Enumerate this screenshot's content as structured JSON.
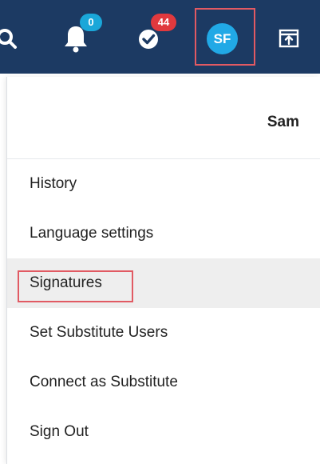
{
  "header": {
    "notifications_count": "0",
    "tasks_count": "44",
    "avatar_initials": "SF",
    "icons": [
      "search-icon",
      "bell-icon",
      "check-tasks-icon",
      "panel-icon"
    ]
  },
  "user_menu": {
    "user_name": "Sam",
    "items": [
      {
        "label": "History"
      },
      {
        "label": "Language settings"
      },
      {
        "label": "Signatures"
      },
      {
        "label": "Set Substitute Users"
      },
      {
        "label": "Connect as Substitute"
      },
      {
        "label": "Sign Out"
      }
    ]
  },
  "colors": {
    "topbar_bg": "#1c3a63",
    "avatar_bg": "#21a9e6",
    "notif_badge": "#1aa7d9",
    "tasks_badge": "#e0393e",
    "highlight": "#e15a63"
  }
}
